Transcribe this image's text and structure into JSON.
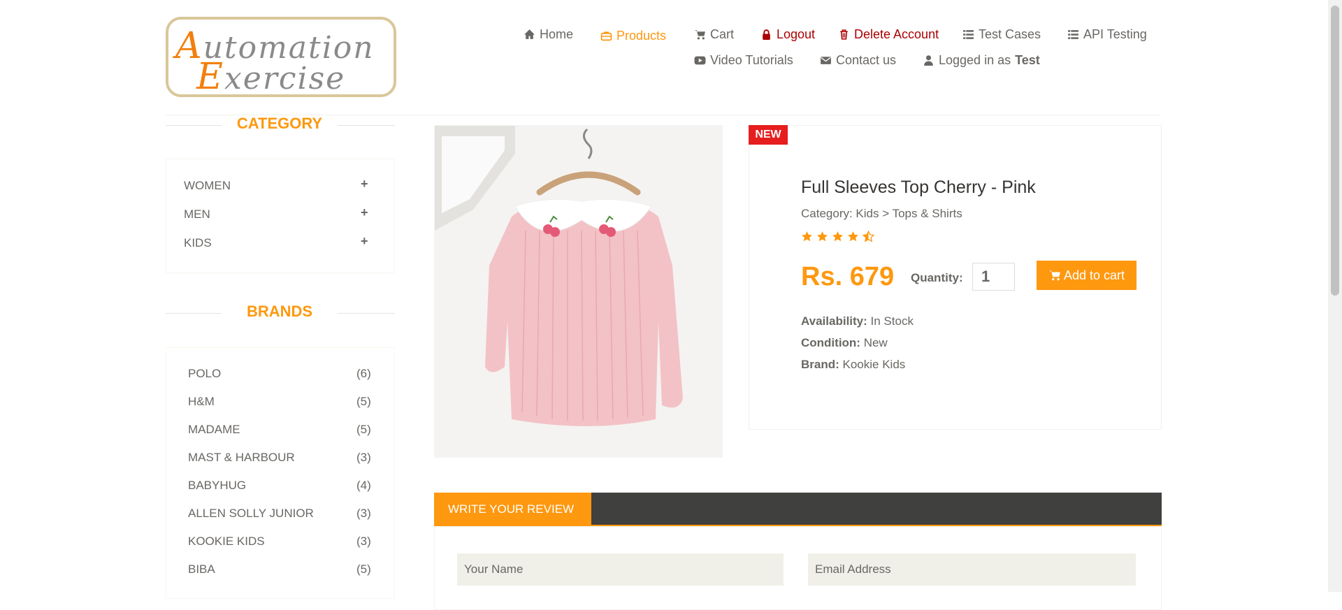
{
  "logo": {
    "line1_cap": "A",
    "line1_rest": "utomation",
    "line2_cap": "E",
    "line2_rest": "xercise"
  },
  "nav": {
    "home": "Home",
    "products": "Products",
    "cart": "Cart",
    "logout": "Logout",
    "delete_account": "Delete Account",
    "test_cases": "Test Cases",
    "api_testing": "API Testing",
    "video_tutorials": "Video Tutorials",
    "contact_us": "Contact us",
    "logged_in_prefix": "Logged in as",
    "logged_in_user": "Test"
  },
  "sidebar": {
    "category_title": "CATEGORY",
    "categories": [
      {
        "label": "WOMEN"
      },
      {
        "label": "MEN"
      },
      {
        "label": "KIDS"
      }
    ],
    "brands_title": "BRANDS",
    "brands": [
      {
        "label": "POLO",
        "count": "(6)"
      },
      {
        "label": "H&M",
        "count": "(5)"
      },
      {
        "label": "MADAME",
        "count": "(5)"
      },
      {
        "label": "MAST & HARBOUR",
        "count": "(3)"
      },
      {
        "label": "BABYHUG",
        "count": "(4)"
      },
      {
        "label": "ALLEN SOLLY JUNIOR",
        "count": "(3)"
      },
      {
        "label": "KOOKIE KIDS",
        "count": "(3)"
      },
      {
        "label": "BIBA",
        "count": "(5)"
      }
    ]
  },
  "product": {
    "badge": "NEW",
    "name": "Full Sleeves Top Cherry - Pink",
    "category": "Category: Kids > Tops & Shirts",
    "rating": 4.5,
    "price": "Rs. 679",
    "quantity_label": "Quantity:",
    "quantity_value": "1",
    "add_to_cart": "Add to cart",
    "availability_label": "Availability:",
    "availability_value": "In Stock",
    "condition_label": "Condition:",
    "condition_value": "New",
    "brand_label": "Brand:",
    "brand_value": "Kookie Kids"
  },
  "review": {
    "tab_label": "WRITE YOUR REVIEW",
    "name_placeholder": "Your Name",
    "email_placeholder": "Email Address"
  },
  "colors": {
    "accent": "#FE980F",
    "danger": "#a00",
    "badge": "#e61e1e",
    "review_bar": "#40403e"
  }
}
